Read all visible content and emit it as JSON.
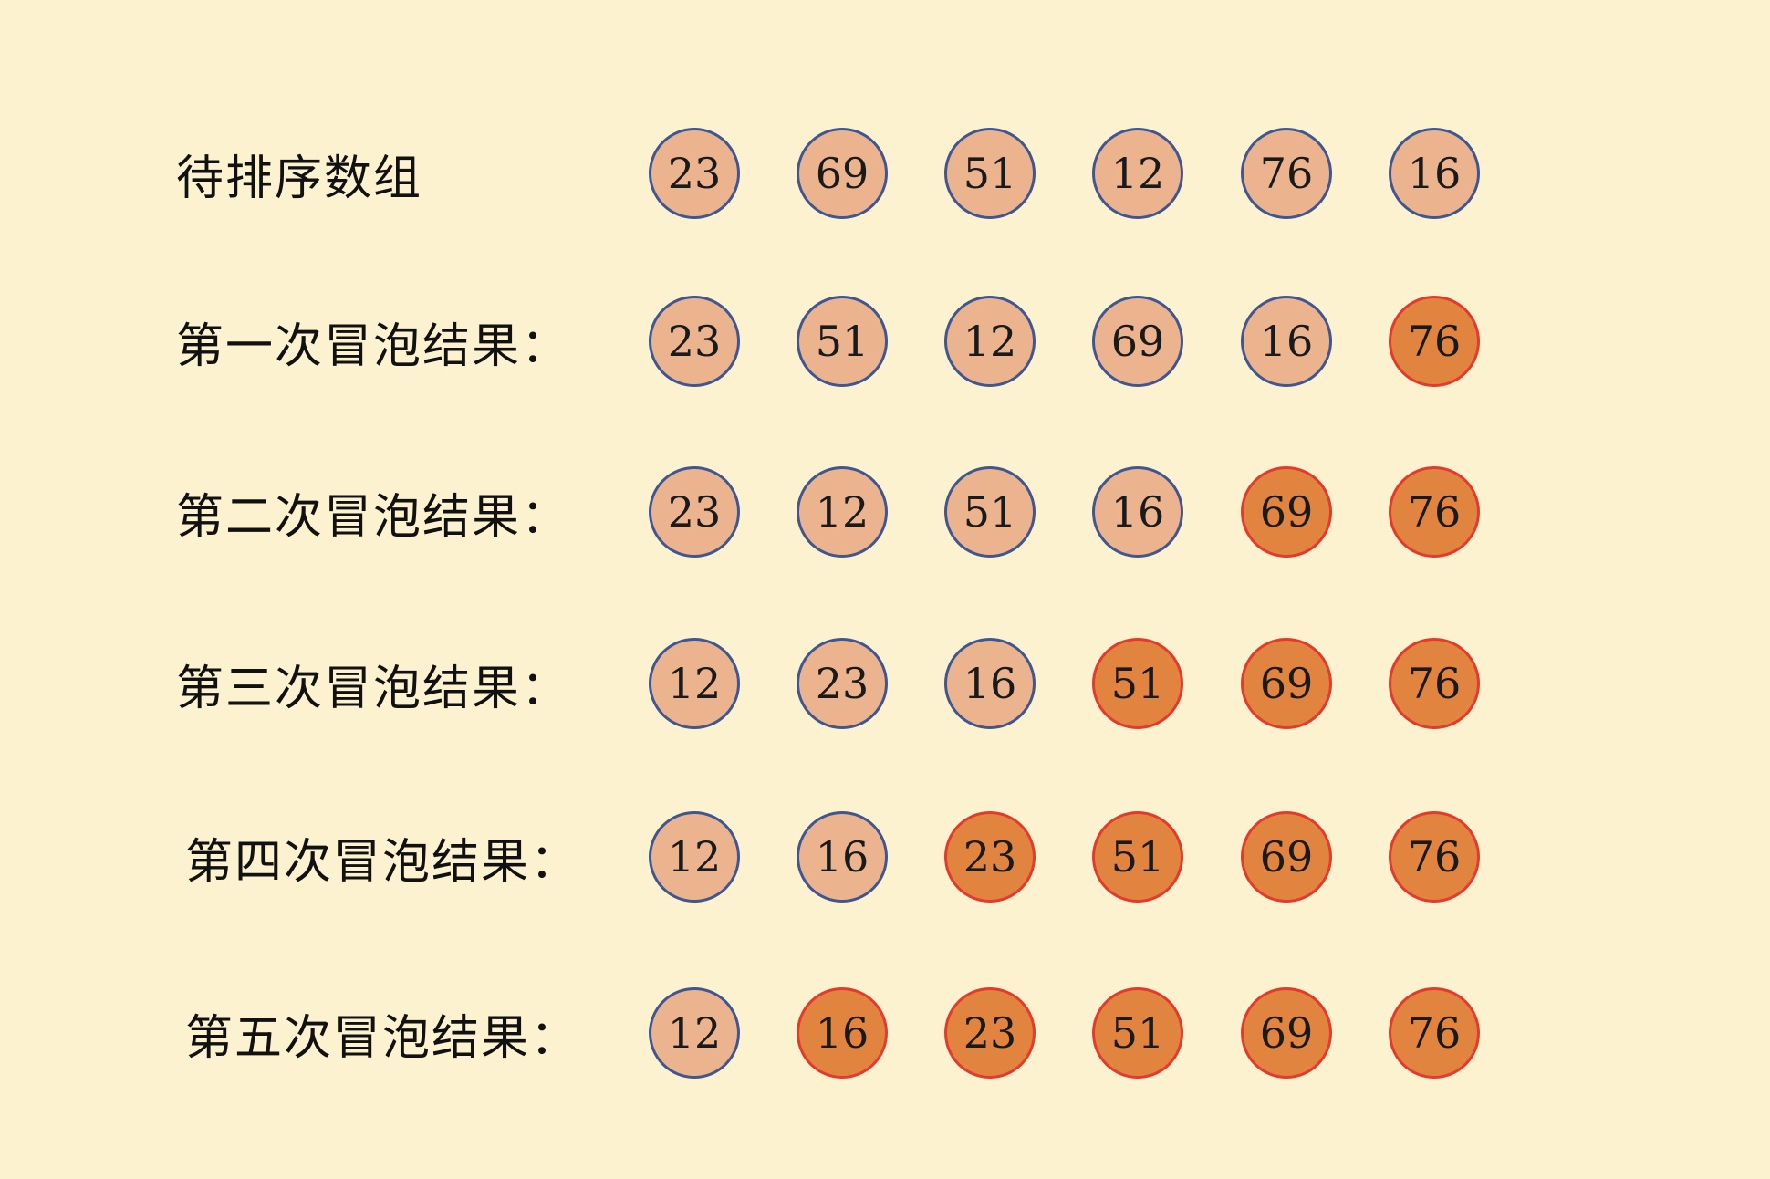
{
  "colors": {
    "background": "#fdf2d0",
    "unsorted_fill": "#ebb48f",
    "unsorted_border": "#3f5690",
    "sorted_fill": "#e0843f",
    "sorted_border": "#e33a2c"
  },
  "rows": [
    {
      "label": "待排序数组",
      "values": [
        "23",
        "69",
        "51",
        "12",
        "76",
        "16"
      ],
      "sorted_count": 0
    },
    {
      "label": "第一次冒泡结果：",
      "values": [
        "23",
        "51",
        "12",
        "69",
        "16",
        "76"
      ],
      "sorted_count": 1
    },
    {
      "label": "第二次冒泡结果：",
      "values": [
        "23",
        "12",
        "51",
        "16",
        "69",
        "76"
      ],
      "sorted_count": 2
    },
    {
      "label": "第三次冒泡结果：",
      "values": [
        "12",
        "23",
        "16",
        "51",
        "69",
        "76"
      ],
      "sorted_count": 3
    },
    {
      "label": "第四次冒泡结果：",
      "values": [
        "12",
        "16",
        "23",
        "51",
        "69",
        "76"
      ],
      "sorted_count": 4
    },
    {
      "label": "第五次冒泡结果：",
      "values": [
        "12",
        "16",
        "23",
        "51",
        "69",
        "76"
      ],
      "sorted_count": 5
    }
  ]
}
